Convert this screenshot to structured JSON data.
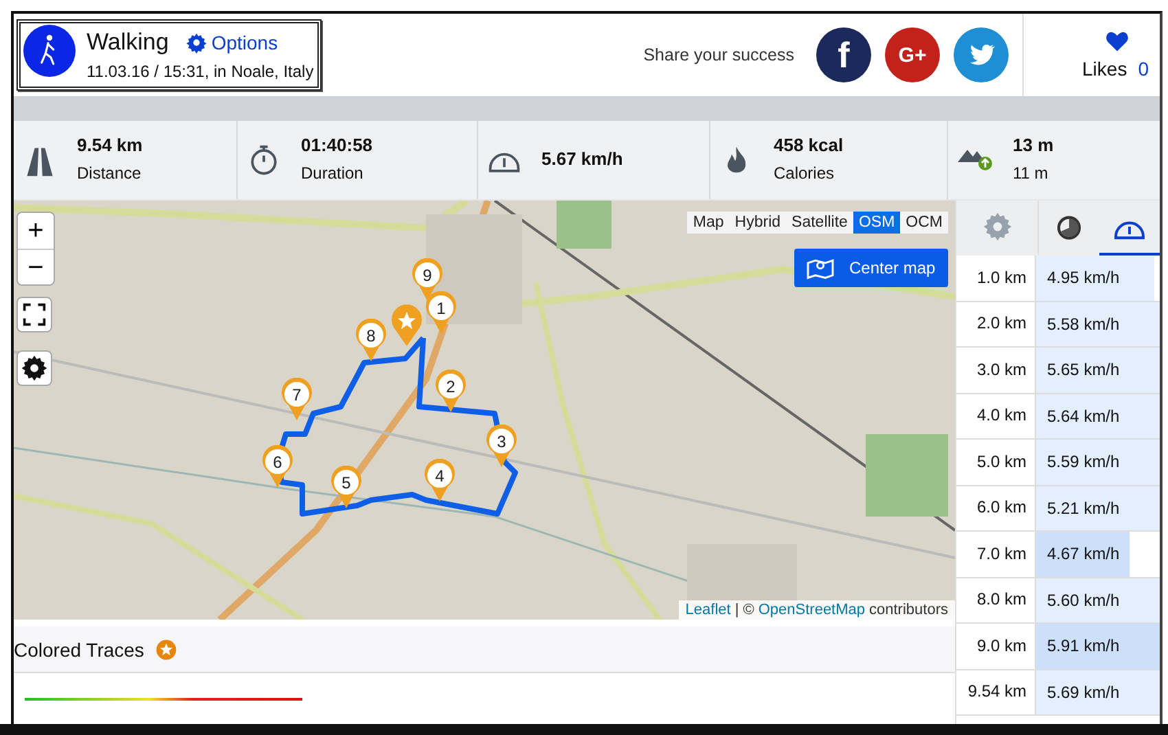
{
  "header": {
    "title": "Walking",
    "options": "Options",
    "subtitle": "11.03.16 / 15:31, in Noale, Italy",
    "share_text": "Share your success",
    "share_buttons": [
      {
        "kind": "facebook",
        "label": "f",
        "color": "#1b2a5a"
      },
      {
        "kind": "googleplus",
        "label": "G+",
        "color": "#c4211b"
      },
      {
        "kind": "twitter",
        "color": "#1e8fd5"
      }
    ],
    "likes_label": "Likes",
    "likes_count": "0"
  },
  "stats": [
    {
      "kind": "distance",
      "value": "9.54 km",
      "label": "Distance"
    },
    {
      "kind": "duration",
      "value": "01:40:58",
      "label": "Duration"
    },
    {
      "kind": "speed",
      "value": "5.67 km/h"
    },
    {
      "kind": "calories",
      "value": "458 kcal",
      "label": "Calories"
    },
    {
      "kind": "elevation",
      "value": "13 m",
      "label": "11 m"
    }
  ],
  "map": {
    "zoom_in": "+",
    "zoom_out": "−",
    "layers": [
      {
        "label": "Map",
        "selected": false
      },
      {
        "label": "Hybrid",
        "selected": false
      },
      {
        "label": "Satellite",
        "selected": false
      },
      {
        "label": "OSM",
        "selected": true
      },
      {
        "label": "OCM",
        "selected": false
      }
    ],
    "center_button": "Center map",
    "markers": [
      "9",
      "1",
      "8",
      "7",
      "2",
      "3",
      "6",
      "5",
      "4"
    ],
    "attribution": {
      "leaflet": "Leaflet",
      "separator": "| ©",
      "osm": "OpenStreetMap",
      "suffix": "contributors"
    }
  },
  "colored_traces": {
    "title": "Colored Traces"
  },
  "splits_tabs": [
    {
      "kind": "settings",
      "selected": false
    },
    {
      "kind": "time",
      "selected": false
    },
    {
      "kind": "speed",
      "selected": true
    }
  ],
  "splits": [
    {
      "distance": "1.0 km",
      "speed": "4.95 km/h",
      "level": 0.95,
      "highlighted": false
    },
    {
      "distance": "2.0 km",
      "speed": "5.58 km/h",
      "level": 1,
      "highlighted": false
    },
    {
      "distance": "3.0 km",
      "speed": "5.65 km/h",
      "level": 1,
      "highlighted": false
    },
    {
      "distance": "4.0 km",
      "speed": "5.64 km/h",
      "level": 1,
      "highlighted": false
    },
    {
      "distance": "5.0 km",
      "speed": "5.59 km/h",
      "level": 1,
      "highlighted": false
    },
    {
      "distance": "6.0 km",
      "speed": "5.21 km/h",
      "level": 1,
      "highlighted": false
    },
    {
      "distance": "7.0 km",
      "speed": "4.67 km/h",
      "level": 0.76,
      "highlighted": true
    },
    {
      "distance": "8.0 km",
      "speed": "5.60 km/h",
      "level": 1,
      "highlighted": false
    },
    {
      "distance": "9.0 km",
      "speed": "5.91 km/h",
      "level": 1,
      "highlighted": true
    },
    {
      "distance": "9.54 km",
      "speed": "5.69 km/h",
      "level": 1,
      "highlighted": false
    }
  ]
}
